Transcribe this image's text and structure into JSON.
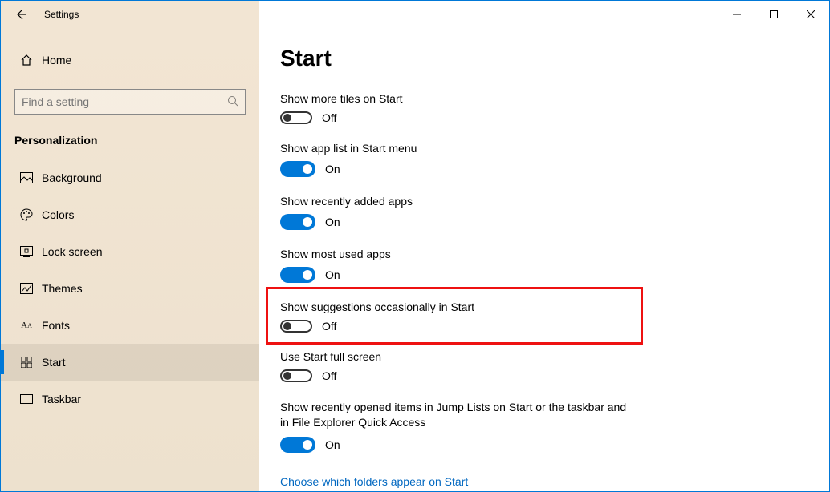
{
  "titlebar": {
    "title": "Settings"
  },
  "sidebar": {
    "home": "Home",
    "search_placeholder": "Find a setting",
    "category": "Personalization",
    "items": [
      {
        "label": "Background"
      },
      {
        "label": "Colors"
      },
      {
        "label": "Lock screen"
      },
      {
        "label": "Themes"
      },
      {
        "label": "Fonts"
      },
      {
        "label": "Start"
      },
      {
        "label": "Taskbar"
      }
    ]
  },
  "main": {
    "heading": "Start",
    "settings": [
      {
        "label": "Show more tiles on Start",
        "on": false,
        "state": "Off"
      },
      {
        "label": "Show app list in Start menu",
        "on": true,
        "state": "On"
      },
      {
        "label": "Show recently added apps",
        "on": true,
        "state": "On"
      },
      {
        "label": "Show most used apps",
        "on": true,
        "state": "On"
      },
      {
        "label": "Show suggestions occasionally in Start",
        "on": false,
        "state": "Off"
      },
      {
        "label": "Use Start full screen",
        "on": false,
        "state": "Off"
      },
      {
        "label": "Show recently opened items in Jump Lists on Start or the taskbar and in File Explorer Quick Access",
        "on": true,
        "state": "On"
      }
    ],
    "link": "Choose which folders appear on Start"
  }
}
